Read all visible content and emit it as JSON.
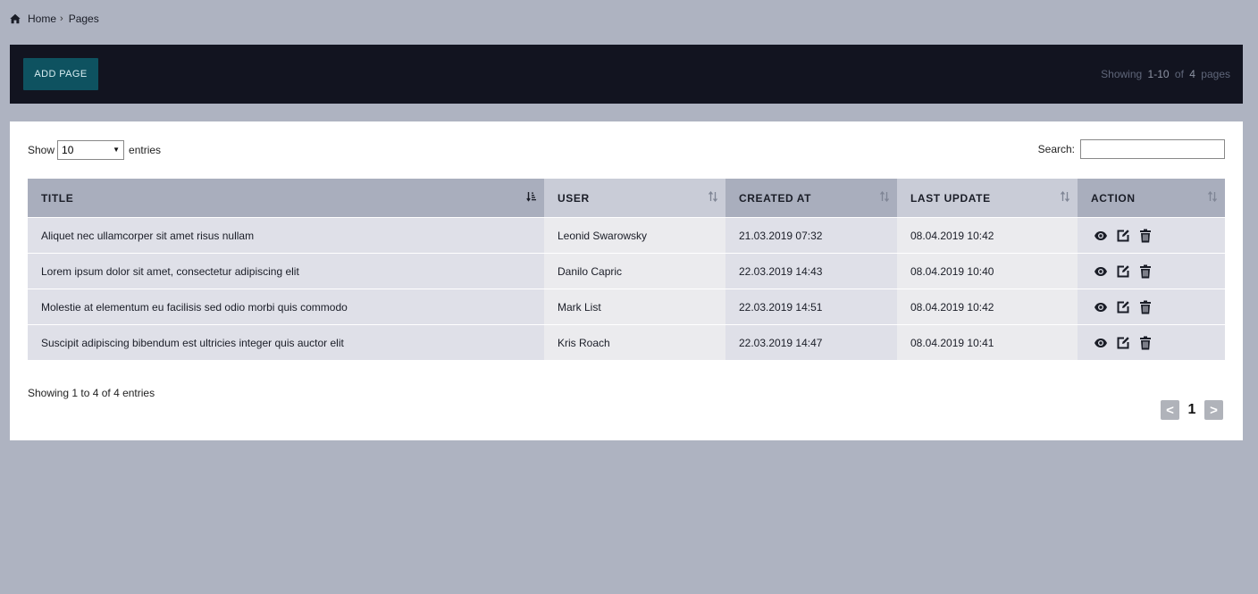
{
  "breadcrumb": {
    "home": "Home",
    "separator": "›",
    "current": "Pages"
  },
  "topbar": {
    "add_button": "ADD PAGE",
    "showing_label": "Showing",
    "range": "1-10",
    "of_label": "of",
    "total": "4",
    "unit": "pages"
  },
  "controls": {
    "show_label": "Show",
    "entries_value": "10",
    "entries_label": "entries",
    "search_label": "Search:",
    "search_value": ""
  },
  "table": {
    "headers": [
      "TITLE",
      "USER",
      "CREATED AT",
      "LAST UPDATE",
      "ACTION"
    ],
    "rows": [
      {
        "title": "Aliquet nec ullamcorper sit amet risus nullam",
        "user": "Leonid Swarowsky",
        "created": "21.03.2019 07:32",
        "updated": "08.04.2019 10:42"
      },
      {
        "title": "Lorem ipsum dolor sit amet, consectetur adipiscing elit",
        "user": "Danilo Capric",
        "created": "22.03.2019 14:43",
        "updated": "08.04.2019 10:40"
      },
      {
        "title": "Molestie at elementum eu facilisis sed odio morbi quis commodo",
        "user": "Mark List",
        "created": "22.03.2019 14:51",
        "updated": "08.04.2019 10:42"
      },
      {
        "title": "Suscipit adipiscing bibendum est ultricies integer quis auctor elit",
        "user": "Kris Roach",
        "created": "22.03.2019 14:47",
        "updated": "08.04.2019 10:41"
      }
    ],
    "action_icons": [
      "eye-icon",
      "edit-icon",
      "trash-icon"
    ]
  },
  "footer": {
    "info": "Showing 1 to 4 of 4 entries",
    "prev": "<",
    "page": "1",
    "next": ">"
  },
  "colors": {
    "background": "#aeb3c1",
    "topbar": "#121420",
    "button": "#0e5260",
    "header_dark": "#a9aebd",
    "header_light": "#c9ccd7"
  }
}
